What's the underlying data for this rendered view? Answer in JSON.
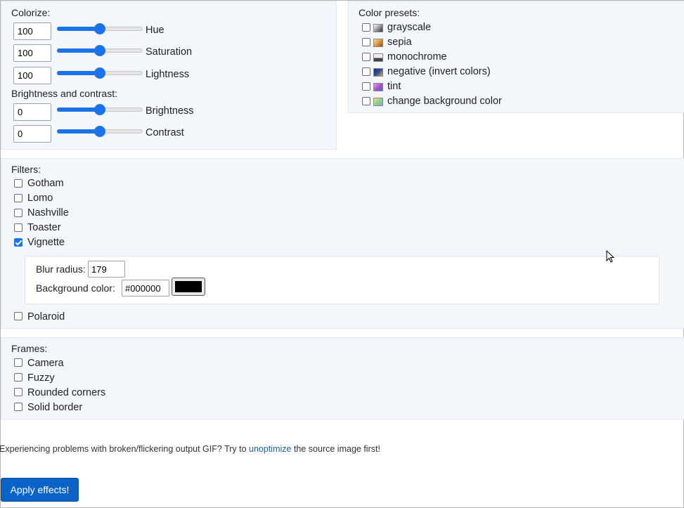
{
  "colorize": {
    "title": "Colorize:",
    "rows": [
      {
        "value": "100",
        "label": "Hue",
        "level": 0.5
      },
      {
        "value": "100",
        "label": "Saturation",
        "level": 0.5
      },
      {
        "value": "100",
        "label": "Lightness",
        "level": 0.5
      }
    ]
  },
  "brightness_contrast": {
    "title": "Brightness and contrast:",
    "rows": [
      {
        "value": "0",
        "label": "Brightness",
        "level": 0.5
      },
      {
        "value": "0",
        "label": "Contrast",
        "level": 0.5
      }
    ]
  },
  "color_presets": {
    "title": "Color presets:",
    "items": [
      {
        "label": "grayscale",
        "checked": false
      },
      {
        "label": "sepia",
        "checked": false
      },
      {
        "label": "monochrome",
        "checked": false
      },
      {
        "label": "negative (invert colors)",
        "checked": false
      },
      {
        "label": "tint",
        "checked": false
      },
      {
        "label": "change background color",
        "checked": false
      }
    ]
  },
  "filters": {
    "title": "Filters:",
    "items": [
      {
        "label": "Gotham",
        "checked": false
      },
      {
        "label": "Lomo",
        "checked": false
      },
      {
        "label": "Nashville",
        "checked": false
      },
      {
        "label": "Toaster",
        "checked": false
      },
      {
        "label": "Vignette",
        "checked": true
      }
    ],
    "vignette": {
      "blur_label": "Blur radius:",
      "blur_value": "179",
      "bg_label": "Background color:",
      "bg_value": "#000000",
      "bg_color": "#000000"
    },
    "polaroid": {
      "label": "Polaroid",
      "checked": false
    }
  },
  "frames": {
    "title": "Frames:",
    "items": [
      {
        "label": "Camera",
        "checked": false
      },
      {
        "label": "Fuzzy",
        "checked": false
      },
      {
        "label": "Rounded corners",
        "checked": false
      },
      {
        "label": "Solid border",
        "checked": false
      }
    ]
  },
  "note": {
    "before": "Experiencing problems with broken/flickering output GIF? Try to ",
    "link": "unoptimize",
    "after": " the source image first!"
  },
  "apply_button": "Apply effects!",
  "colors": {
    "accent": "#1a73e8",
    "button": "#0b63c8",
    "link": "#1d6098"
  }
}
